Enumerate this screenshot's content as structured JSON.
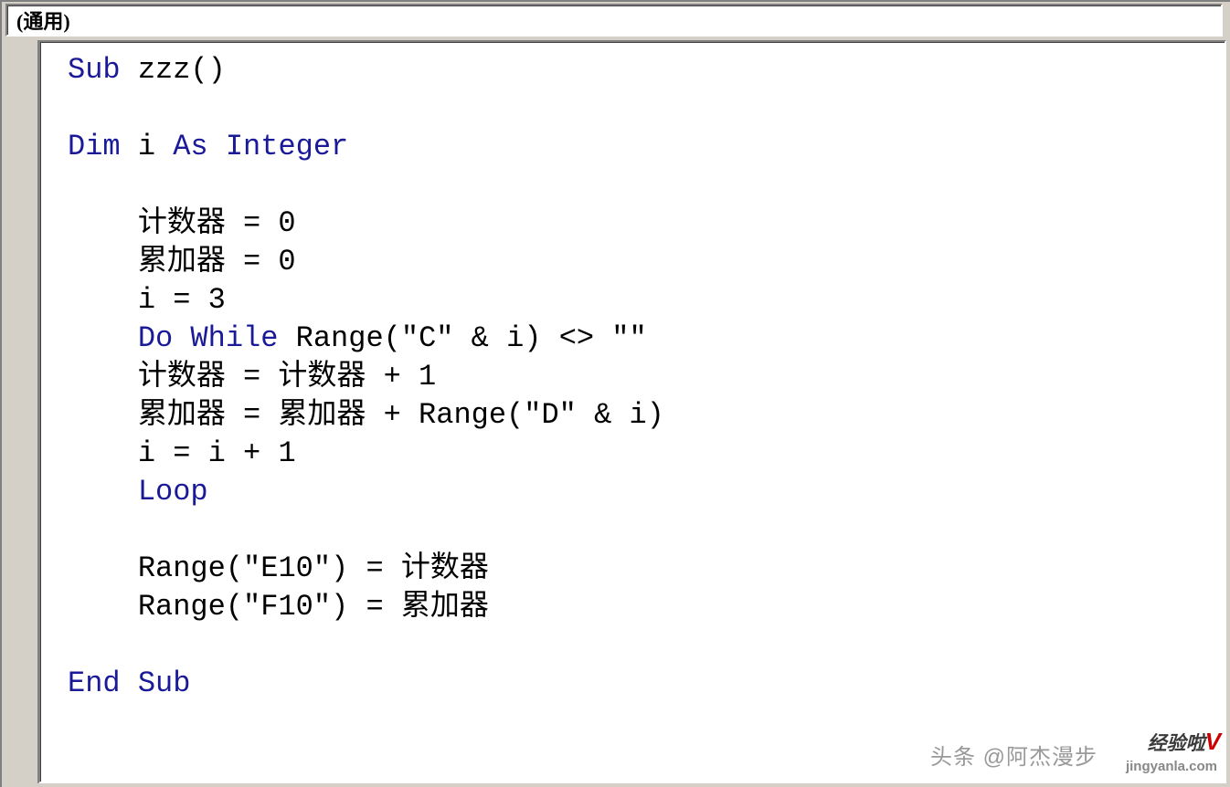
{
  "dropdown": {
    "selected": "(通用)"
  },
  "code": {
    "line1_kw": "Sub",
    "line1_rest": " zzz()",
    "line2": "",
    "line3_kw1": "Dim",
    "line3_mid": " i ",
    "line3_kw2": "As Integer",
    "line4": "",
    "line5": "    计数器 = 0",
    "line6": "    累加器 = 0",
    "line7": "    i = 3",
    "line8_pre": "    ",
    "line8_kw": "Do While",
    "line8_rest": " Range(\"C\" & i) <> \"\"",
    "line9": "    计数器 = 计数器 + 1",
    "line10": "    累加器 = 累加器 + Range(\"D\" & i)",
    "line11": "    i = i + 1",
    "line12_pre": "    ",
    "line12_kw": "Loop",
    "line13": "",
    "line14": "    Range(\"E10\") = 计数器",
    "line15": "    Range(\"F10\") = 累加器",
    "line16": "",
    "line17_kw": "End Sub"
  },
  "watermarks": {
    "w1": "头条 @阿杰漫步",
    "w2a": "经验啦",
    "w2b": "V",
    "w3": "jingyanla.com"
  }
}
